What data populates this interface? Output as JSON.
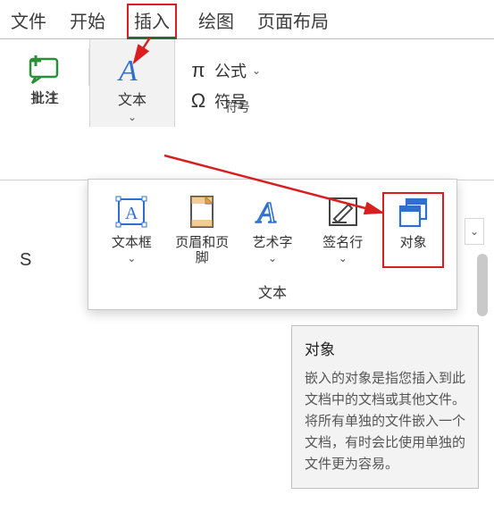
{
  "tabs": {
    "file": "文件",
    "home": "开始",
    "insert": "插入",
    "draw": "绘图",
    "layout": "页面布局"
  },
  "ribbon": {
    "comment": {
      "label": "批注",
      "group": "批注"
    },
    "text_big": {
      "label": "文本"
    },
    "formula": {
      "label": "公式"
    },
    "symbol": {
      "label": "符号"
    },
    "symbols_group": "符号"
  },
  "dropdown": {
    "textbox": {
      "label": "文本框"
    },
    "headerfooter": {
      "label": "页眉和页脚"
    },
    "wordart": {
      "label": "艺术字"
    },
    "signature": {
      "label": "签名行"
    },
    "object": {
      "label": "对象"
    },
    "group": "文本"
  },
  "tooltip": {
    "title": "对象",
    "body": "嵌入的对象是指您插入到此文档中的文档或其他文件。将所有单独的文件嵌入一个文档，有时会比使用单独的文件更为容易。"
  },
  "cell": {
    "name_box": "S"
  },
  "chev": "⌄"
}
